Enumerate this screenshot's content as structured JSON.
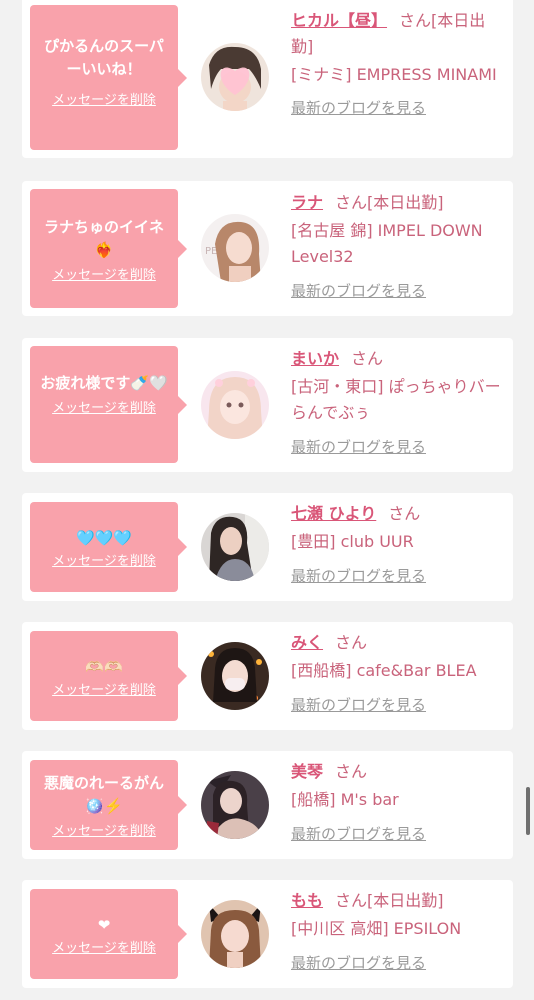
{
  "items": [
    {
      "message": "ぴかるんのスーパーいいね！",
      "delete_label": "メッセージを削除",
      "name": "ヒカル【昼】",
      "honorific": "さん",
      "status": "[本日出勤]",
      "shop": "[ミナミ] EMPRESS MINAMI",
      "blog_label": "最新のブログを見る",
      "avatar_icon": "heart-sticker-avatar"
    },
    {
      "message": "ラナちゅのイイネ❤️‍🔥",
      "delete_label": "メッセージを削除",
      "name": "ラナ",
      "honorific": "さん",
      "status": "[本日出勤]",
      "shop": "[名古屋 錦] IMPEL DOWN Level32",
      "blog_label": "最新のブログを見る",
      "avatar_icon": "girl-portrait-avatar"
    },
    {
      "message": "お疲れ様です🍼🤍",
      "delete_label": "メッセージを削除",
      "name": "まいか",
      "honorific": "さん",
      "status": "",
      "shop": "[古河・東口] ぽっちゃりバー らんでぶぅ",
      "blog_label": "最新のブログを見る",
      "avatar_icon": "girl-portrait-avatar"
    },
    {
      "message": "🩵🩵🩵",
      "delete_label": "メッセージを削除",
      "name": "七瀬 ひより",
      "honorific": "さん",
      "status": "",
      "shop": "[豊田] club UUR",
      "blog_label": "最新のブログを見る",
      "avatar_icon": "girl-portrait-avatar"
    },
    {
      "message": "🫶🏻🫶🏻",
      "delete_label": "メッセージを削除",
      "name": "みく",
      "honorific": "さん",
      "status": "",
      "shop": "[西船橋] cafe&Bar BLEA",
      "blog_label": "最新のブログを見る",
      "avatar_icon": "girl-portrait-avatar"
    },
    {
      "message": "悪魔のれーるがん🪩⚡️",
      "delete_label": "メッセージを削除",
      "name": "美琴",
      "honorific": "さん",
      "status": "",
      "shop": "[船橋] M's bar",
      "blog_label": "最新のブログを見る",
      "avatar_icon": "girl-portrait-avatar"
    },
    {
      "message": "❤︎",
      "delete_label": "メッセージを削除",
      "name": "もも",
      "honorific": "さん",
      "status": "[本日出勤]",
      "shop": "[中川区 高畑] EPSILON",
      "blog_label": "最新のブログを見る",
      "avatar_icon": "girl-cat-ears-avatar"
    }
  ],
  "colors": {
    "bubble": "#f9a2ab",
    "name": "#d95678",
    "text": "#c9637b",
    "link_gray": "#9a9a9a",
    "background": "#f2f2f2"
  }
}
